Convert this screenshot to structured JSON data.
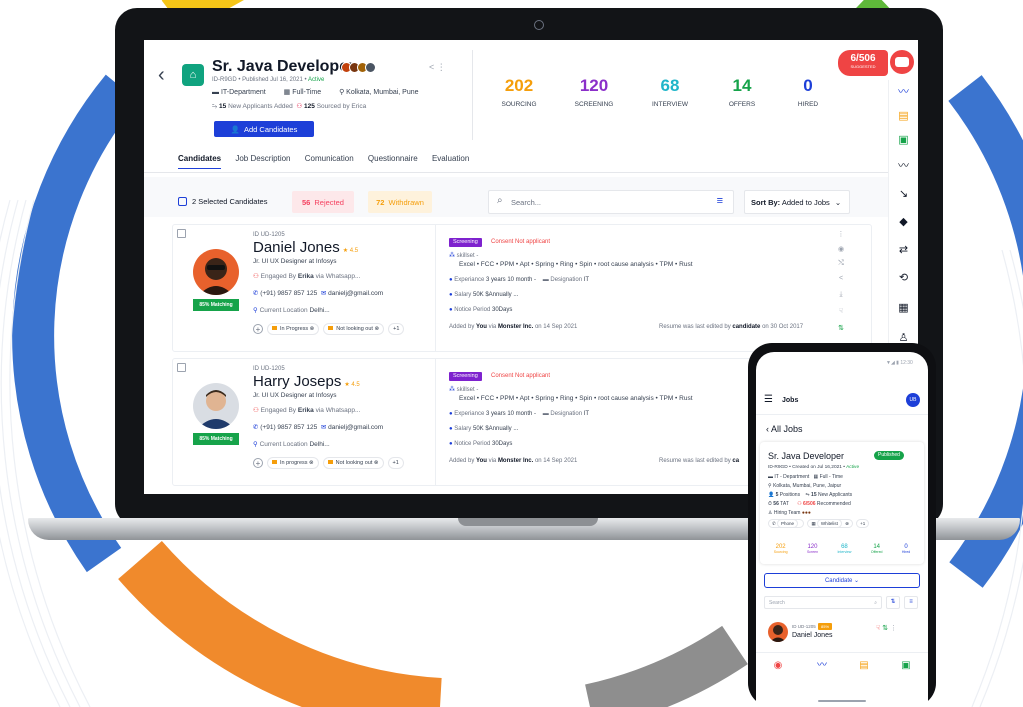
{
  "job": {
    "title": "Sr. Java Developer",
    "meta_id": "ID-R9GD",
    "meta_published": "Published Jul 16, 2021",
    "meta_status": "Active",
    "department": "IT-Department",
    "type": "Full-Time",
    "locations": "Kolkata, Mumbai, Pune",
    "new_applicants": "15",
    "new_applicants_label": "New Applicants Added",
    "sourced_count": "125",
    "sourced_label": "Sourced by Erica",
    "add_button": "Add Candidates"
  },
  "pipeline": [
    {
      "value": "202",
      "label": "SOURCING",
      "color": "#f59e0b"
    },
    {
      "value": "120",
      "label": "SCREENING",
      "color": "#8b2fc9"
    },
    {
      "value": "68",
      "label": "INTERVIEW",
      "color": "#1fb5c9"
    },
    {
      "value": "14",
      "label": "OFFERS",
      "color": "#16a34a"
    },
    {
      "value": "0",
      "label": "HIRED",
      "color": "#1d3fd8"
    }
  ],
  "suggested": {
    "count": "6/506",
    "label": "SUGGESTED"
  },
  "tabs": [
    "Candidates",
    "Job Description",
    "Comunication",
    "Questionnaire",
    "Evaluation"
  ],
  "toolbar": {
    "selected": "2 Selected Candidates",
    "rejected_count": "56",
    "rejected_label": "Rejected",
    "withdrawn_count": "72",
    "withdrawn_label": "Withdrawn",
    "search_placeholder": "Search...",
    "sort_label": "Sort By:",
    "sort_value": "Added to Jobs"
  },
  "candidates": [
    {
      "id": "ID UD-1205",
      "name": "Daniel Jones",
      "rating": "4.5",
      "role": "Jr. UI UX Designer at Infosys",
      "engaged": "Engaged By",
      "engaged_by": "Erika",
      "engaged_via": "via Whatsapp...",
      "phone": "(+91) 9857 857 125",
      "email": "danielj@gmail.com",
      "location_label": "Current Location",
      "location": "Delhi...",
      "match": "85% Matching",
      "tag1": "In Progress",
      "tag2": "Not looking out",
      "tag_more": "+1",
      "stage": "Screening",
      "consent": "Consent Not applicant",
      "skill_label": "skillset -",
      "skills": "Excel • FCC • PPM • Apt • Spring • Ring • Spin • root cause analysis • TPM • Rust",
      "exp_label": "Experiance",
      "exp": "3 years 10 month -",
      "designation_label": "Designation",
      "designation": "IT",
      "salary_label": "Salary",
      "salary": "50K $Annually ...",
      "notice_label": "Notice Period",
      "notice": "30Days",
      "added_prefix": "Added by",
      "added_by": "You",
      "added_via": "via",
      "added_source": "Monster Inc.",
      "added_on": "on 14 Sep 2021",
      "edited_prefix": "Resume was last edited by",
      "edited_by": "candidate",
      "edited_on": "on 30 Oct 2017"
    },
    {
      "id": "ID UD-1205",
      "name": "Harry Joseps",
      "rating": "4.5",
      "role": "Jr. UI UX Designer at Infosys",
      "engaged": "Engaged By",
      "engaged_by": "Erika",
      "engaged_via": "via Whatsapp...",
      "phone": "(+91) 9857 857 125",
      "email": "danielj@gmail.com",
      "location_label": "Current Location",
      "location": "Delhi...",
      "match": "85% Matching",
      "tag1": "In progress",
      "tag2": "Not looking out",
      "tag_more": "+1",
      "stage": "Screening",
      "consent": "Consent Not applicant",
      "skill_label": "skillset -",
      "skills": "Excel • FCC • PPM • Apt • Spring • Ring • Spin • root cause analysis • TPM • Rust",
      "exp_label": "Experiance",
      "exp": "3 years 10 month -",
      "designation_label": "Designation",
      "designation": "IT",
      "salary_label": "Salary",
      "salary": "50K $Annually ...",
      "notice_label": "Notice Period",
      "notice": "30Days",
      "added_prefix": "Added by",
      "added_by": "You",
      "added_via": "via",
      "added_source": "Monster Inc.",
      "added_on": "on 14 Sep 2021",
      "edited_prefix": "Resume was last edited by",
      "edited_by": "ca"
    }
  ],
  "mobile": {
    "time": "12:30",
    "header": "Jobs",
    "user_initials": "UB",
    "back": "All Jobs",
    "job_title": "Sr. Java Developer",
    "published": "Published",
    "meta_id": "ID-R9GD",
    "meta_created": "Created on Jul 16,2021",
    "meta_status": "Active",
    "department": "IT - Department",
    "type": "Full - Time",
    "locations": "Kolkata, Mumbai, Pune, Jaipur",
    "positions_count": "5",
    "positions_label": "Positions",
    "applicants_count": "15",
    "applicants_label": "New Applicants",
    "tat_count": "56",
    "tat_label": "TAT",
    "recommended_count": "6/506",
    "recommended_label": "Recommended",
    "hiring_team": "Hiring Team",
    "tag_phone": "Phone",
    "tag_whitelist": "Whitelist",
    "tag_more": "+1",
    "stats": [
      {
        "value": "202",
        "label": "Sourcing",
        "color": "#f59e0b"
      },
      {
        "value": "120",
        "label": "Screen",
        "color": "#8b2fc9"
      },
      {
        "value": "68",
        "label": "Interview",
        "color": "#1fb5c9"
      },
      {
        "value": "14",
        "label": "Offered",
        "color": "#16a34a"
      },
      {
        "value": "0",
        "label": "Hired",
        "color": "#1d3fd8"
      }
    ],
    "candidate_button": "Candidate",
    "search_placeholder": "Search",
    "cand_id": "ID UD-1205",
    "cand_pct": "85%",
    "cand_name": "Daniel Jones"
  },
  "colors": {
    "primary": "#1d3fd8",
    "danger": "#ef4444",
    "success": "#16a34a",
    "warning": "#f59e0b",
    "deco_yellow": "#f5c518",
    "deco_green": "#5fb83a",
    "deco_blue": "#3b74cf",
    "deco_orange": "#f08a2c"
  }
}
